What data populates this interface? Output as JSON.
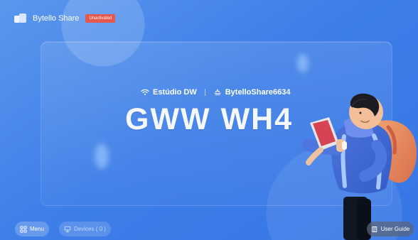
{
  "header": {
    "app_name": "Bytello Share",
    "status": "Unactivated"
  },
  "connection": {
    "wifi_name": "Estúdio DW",
    "share_code": "BytelloShare6634"
  },
  "main": {
    "device_name": "GWW WH4"
  },
  "footer": {
    "menu_label": "Menu",
    "devices_label": "Devices ( 0 )",
    "guide_label": "User Guide"
  },
  "icons": {
    "logo": "bytello-logo-icon",
    "wifi": "wifi-icon",
    "share": "share-icon",
    "menu": "menu-grid-icon",
    "devices": "devices-icon",
    "guide": "user-guide-icon"
  },
  "colors": {
    "background": "#3D7EE8",
    "badge": "#E7584C",
    "text": "#FFFFFF"
  }
}
